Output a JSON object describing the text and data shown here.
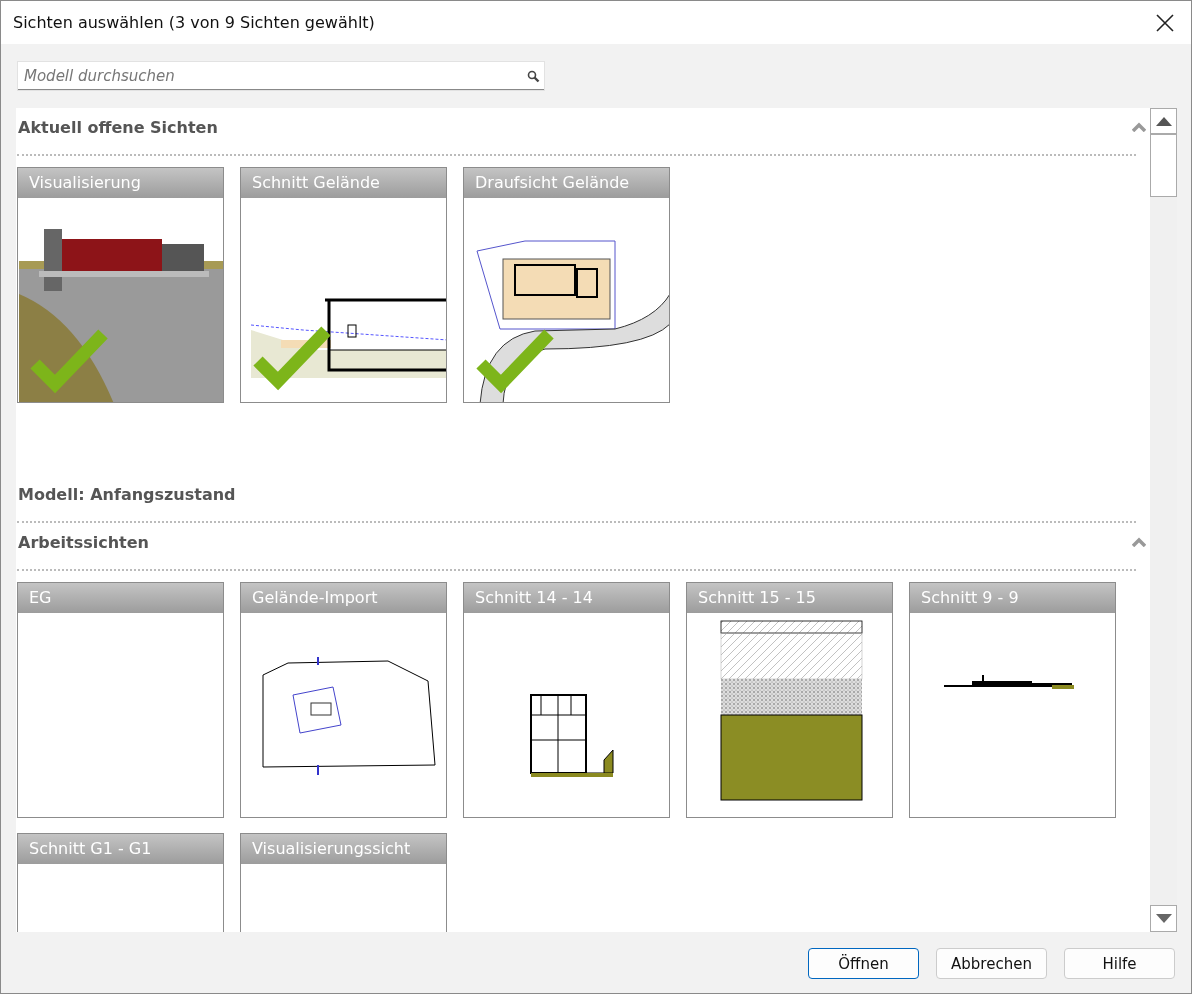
{
  "window": {
    "title": "Sichten auswählen (3 von 9 Sichten gewählt)"
  },
  "search": {
    "placeholder": "Modell durchsuchen"
  },
  "sections": [
    {
      "kind": "category",
      "title": "Aktuell offene Sichten",
      "expanded": true,
      "views": [
        {
          "label": "Visualisierung",
          "checked": true,
          "kind": "render"
        },
        {
          "label": "Schnitt Gelände",
          "checked": true,
          "kind": "section"
        },
        {
          "label": "Draufsicht Gelände",
          "checked": true,
          "kind": "site-plan"
        }
      ]
    },
    {
      "kind": "model",
      "title": "Modell: Anfangszustand"
    },
    {
      "kind": "category",
      "title": "Arbeitssichten",
      "expanded": true,
      "views": [
        {
          "label": "EG",
          "checked": false,
          "kind": "blank"
        },
        {
          "label": "Gelände-Import",
          "checked": false,
          "kind": "terrain"
        },
        {
          "label": "Schnitt 14 - 14",
          "checked": false,
          "kind": "building-section"
        },
        {
          "label": "Schnitt 15 - 15",
          "checked": false,
          "kind": "layers"
        },
        {
          "label": "Schnitt 9 - 9",
          "checked": false,
          "kind": "profile"
        },
        {
          "label": "Schnitt G1 - G1",
          "checked": false,
          "kind": "blank"
        },
        {
          "label": "Visualisierungssicht",
          "checked": false,
          "kind": "blank"
        }
      ]
    }
  ],
  "buttons": [
    {
      "label": "Öffnen",
      "default": true
    },
    {
      "label": "Abbrechen",
      "default": false
    },
    {
      "label": "Hilfe",
      "default": false
    }
  ]
}
